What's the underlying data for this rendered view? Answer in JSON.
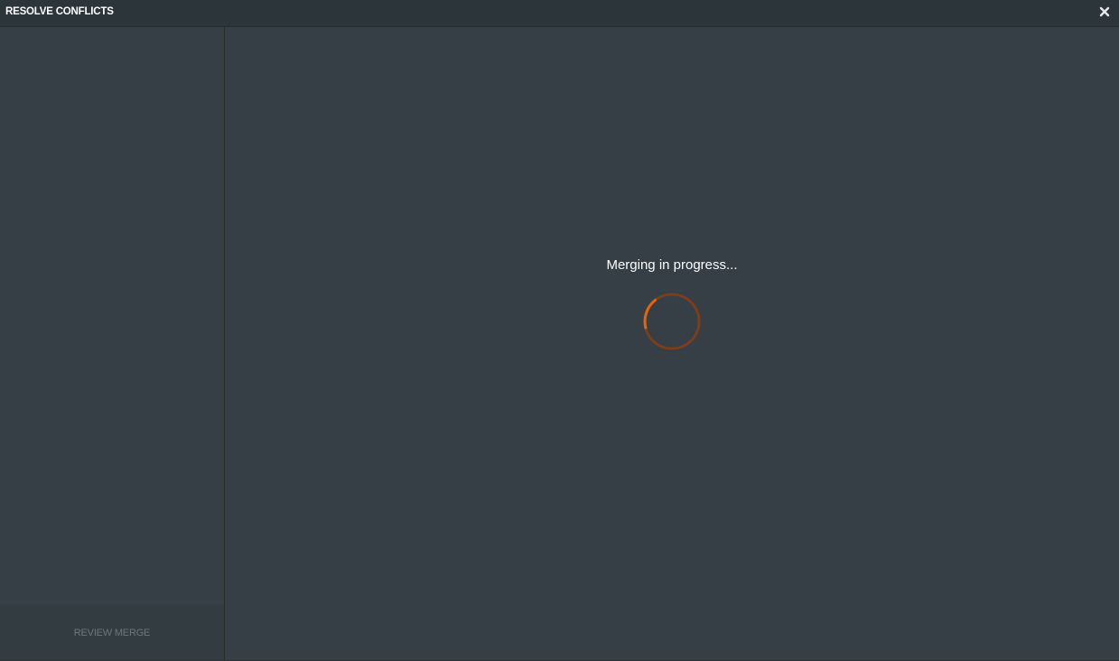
{
  "window": {
    "title": "RESOLVE CONFLICTS",
    "close_icon": "close-icon"
  },
  "sidebar": {
    "footer_button_label": "REVIEW MERGE"
  },
  "main": {
    "status_message": "Merging in progress...",
    "spinner_icon": "loading-spinner-icon"
  },
  "colors": {
    "background": "#353f45",
    "titlebar": "#2c353a",
    "spinner_active": "#e8620c",
    "spinner_track": "#7a3d1e",
    "muted_text": "#6e777b"
  }
}
